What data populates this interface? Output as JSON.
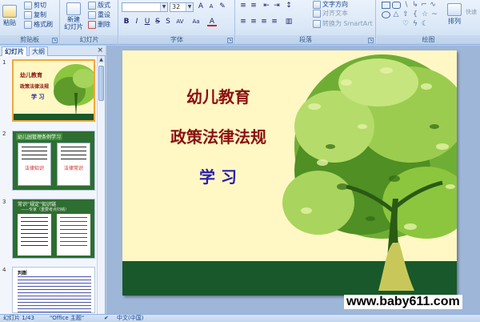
{
  "ribbon": {
    "clipboard": {
      "paste": "粘贴",
      "cut": "剪切",
      "copy": "复制",
      "format_painter": "格式刷",
      "label": "剪贴板"
    },
    "slides": {
      "new_slide": "新建\n幻灯片",
      "layout": "版式",
      "reset": "重设",
      "delete": "删除",
      "label": "幻灯片"
    },
    "font": {
      "font_name": "",
      "font_size": "32",
      "label": "字体"
    },
    "paragraph": {
      "text_direction": "文字方向",
      "align_text": "对齐文本",
      "smartart": "转换为 SmartArt",
      "label": "段落"
    },
    "drawing": {
      "arrange": "排列",
      "quick": "快速",
      "label": "绘图"
    }
  },
  "panel": {
    "tab_slides": "幻灯片",
    "tab_outline": "大纲",
    "close": "×",
    "thumbs": [
      {
        "num": "1",
        "line1": "幼儿教育",
        "line2": "政策法律法规",
        "line3": "学  习"
      },
      {
        "num": "2",
        "title": "幼儿园管理条例学习",
        "left_text": "法律知识",
        "right_text": "法律常识"
      },
      {
        "num": "3",
        "title": "常识“规定”知识链",
        "sub": "——专家（重要考点归纳）"
      },
      {
        "num": "4",
        "heading": "判断"
      }
    ]
  },
  "slide": {
    "title1": "幼儿教育",
    "title2": "政策法律法规",
    "title3": "学  习",
    "title_color": "#8a1010",
    "subtitle_color": "#2a1fa8",
    "bg": "#fff7c4",
    "band": "#18582a"
  },
  "watermark": "www.baby611.com",
  "status": {
    "slide_info": "幻灯片 1/43",
    "theme": "\"Office 主题\"",
    "language": "中文(中国)"
  }
}
